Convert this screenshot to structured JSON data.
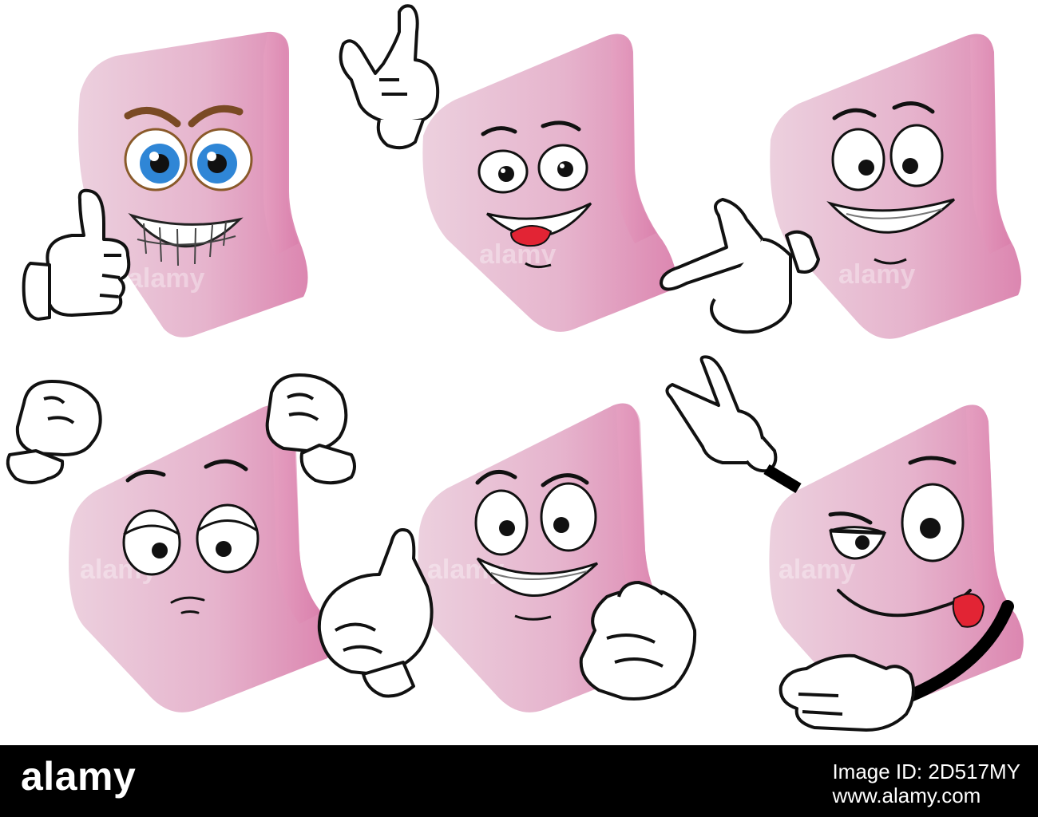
{
  "footer": {
    "logo_text": "alamy",
    "image_id_label": "Image ID: 2D517MY",
    "site": "www.alamy.com",
    "background": "#000000",
    "text_color": "#ffffff"
  },
  "watermark_text": "alamy",
  "colors": {
    "cube_pink_light": "#e8c3d6",
    "cube_pink_dark": "#dc86b0",
    "outline": "#1a1a1a",
    "eye_blue": "#2f86d6",
    "tongue_red": "#e22434"
  },
  "characters": [
    {
      "id": "grin-thumbs-up",
      "expression": "angry grin, blue eyes",
      "gesture": "thumbs-up"
    },
    {
      "id": "happy-tongue",
      "expression": "happy, tongue out",
      "gesture": "rock-horns"
    },
    {
      "id": "big-smile",
      "expression": "big smile",
      "gesture": "pointing"
    },
    {
      "id": "worried",
      "expression": "worried",
      "gesture": "raised fists"
    },
    {
      "id": "grin-hands",
      "expression": "sly grin",
      "gesture": "open hands"
    },
    {
      "id": "wink-tongue",
      "expression": "sly wink, tongue out",
      "gesture": "peace sign"
    }
  ]
}
